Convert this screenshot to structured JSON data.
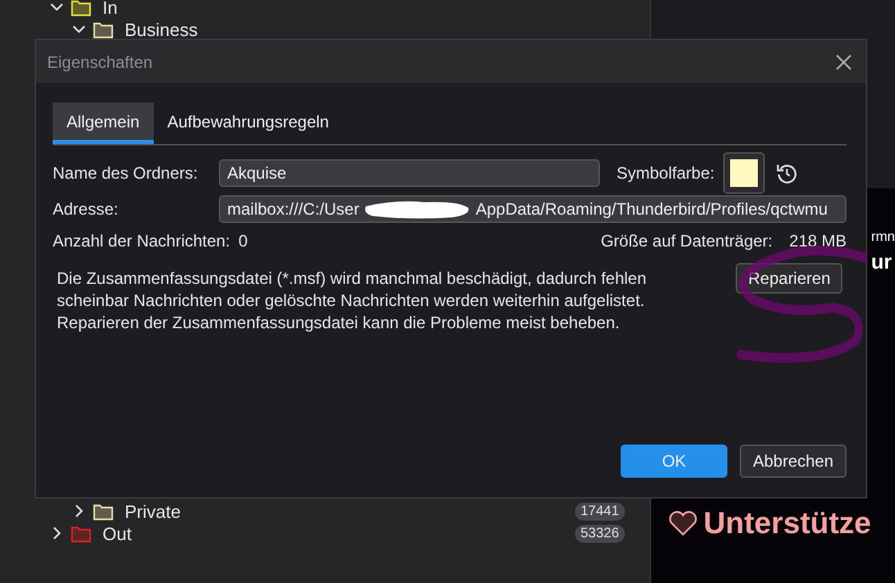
{
  "folder_tree": [
    {
      "name": "In",
      "expanded": true,
      "color": "#e8e03a",
      "children": [
        {
          "name": "Business",
          "expanded": true,
          "color": "#e8dfa8"
        },
        {
          "name": "Private",
          "expanded": false,
          "color": "#e8dfa8",
          "count": "17441"
        }
      ]
    },
    {
      "name": "Out",
      "expanded": false,
      "color": "#e02020",
      "count": "53326"
    }
  ],
  "side_panel": {
    "text_1": "rmn",
    "text_2": "ur",
    "support_link": "Unterstütze"
  },
  "dialog": {
    "title": "Eigenschaften",
    "tabs": [
      {
        "label": "Allgemein",
        "selected": true
      },
      {
        "label": "Aufbewahrungsregeln",
        "selected": false
      }
    ],
    "name_label": "Name des Ordners:",
    "name_value": "Akquise",
    "color_label": "Symbolfarbe:",
    "color_picker": {
      "color": "#fff8c0"
    },
    "address_label": "Adresse:",
    "address_start": "mailbox:///C:/User",
    "address_end": "AppData/Roaming/Thunderbird/Profiles/qctwmu",
    "count_label": "Anzahl der Nachrichten:",
    "count_value": "0",
    "size_label": "Größe auf Datenträger:",
    "size_value": "218 MB",
    "repair_text": "Die Zusammenfassungsdatei (*.msf) wird manchmal beschädigt, dadurch fehlen scheinbar Nachrichten oder gelöschte Nachrichten werden weiterhin aufgelistet. Reparieren der Zusammenfassungsdatei kann die Probleme meist beheben.",
    "repair_button": "Reparieren",
    "buttons": [
      "OK",
      "Abbrechen"
    ]
  }
}
